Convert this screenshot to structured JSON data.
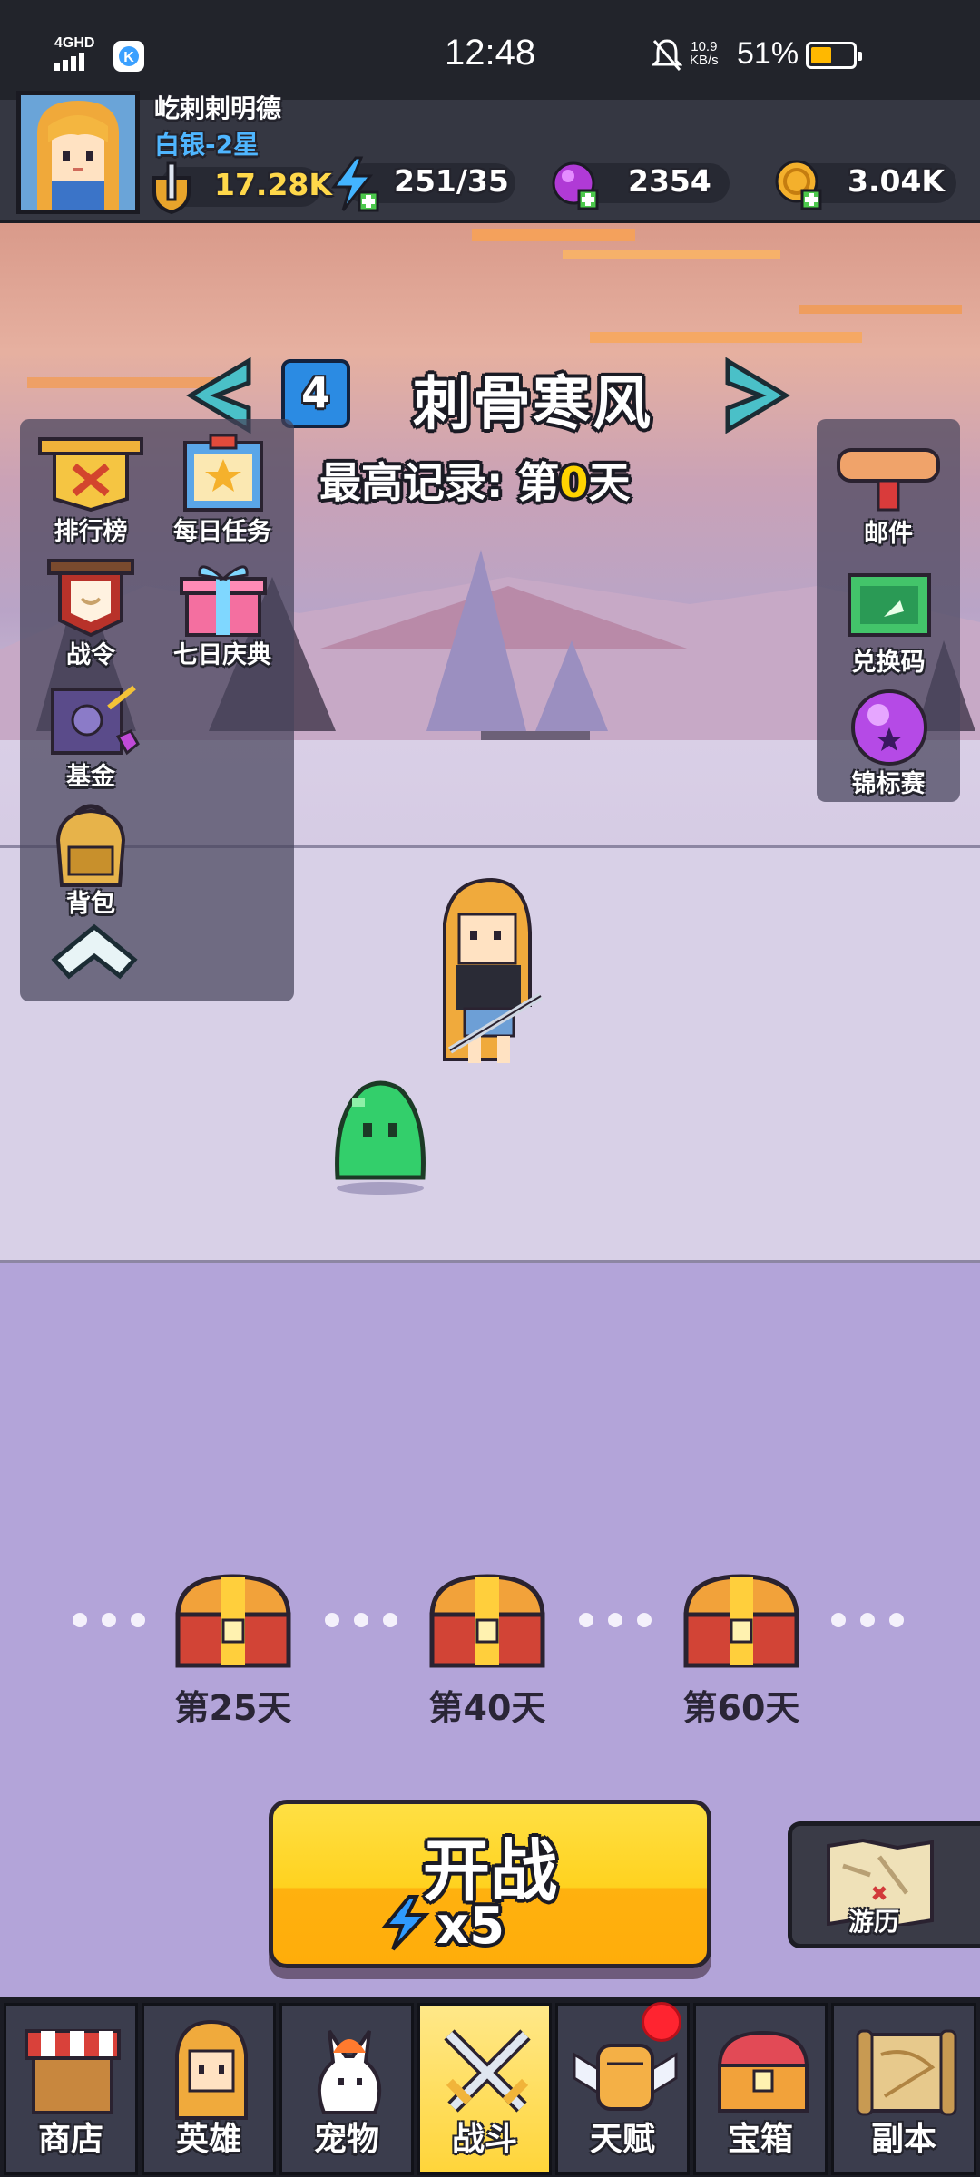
{
  "status_bar": {
    "network": "4GHD",
    "time": "12:48",
    "speed_value": "10.9",
    "speed_unit": "KB/s",
    "battery": "51%",
    "battery_level": 0.51
  },
  "player": {
    "name": "屹剌剌明德",
    "rank": "白银-2星",
    "power": "17.28K",
    "energy": "251/35",
    "gems": "2354",
    "gold": "3.04K"
  },
  "stage": {
    "number": "4",
    "title": "刺骨寒风",
    "record_prefix": "最高记录: 第",
    "record_value": "0",
    "record_suffix": "天"
  },
  "left_menu": [
    {
      "label": "排行榜",
      "icon": "leaderboard-icon"
    },
    {
      "label": "每日任务",
      "icon": "daily-task-icon"
    },
    {
      "label": "战令",
      "icon": "battle-pass-icon"
    },
    {
      "label": "七日庆典",
      "icon": "gift-box-icon"
    },
    {
      "label": "基金",
      "icon": "fund-safe-icon"
    },
    {
      "label": "背包",
      "icon": "backpack-icon"
    }
  ],
  "right_menu": [
    {
      "label": "邮件",
      "icon": "mail-scroll-icon"
    },
    {
      "label": "兑换码",
      "icon": "redeem-code-icon"
    },
    {
      "label": "锦标赛",
      "icon": "tournament-orb-icon"
    }
  ],
  "chests": [
    {
      "label": "第25天"
    },
    {
      "label": "第40天"
    },
    {
      "label": "第60天"
    }
  ],
  "battle_button": {
    "label": "开战",
    "cost": "x5"
  },
  "travel_button": {
    "label": "游历"
  },
  "nav": [
    {
      "label": "商店",
      "icon": "shop-icon",
      "active": false
    },
    {
      "label": "英雄",
      "icon": "hero-icon",
      "active": false
    },
    {
      "label": "宠物",
      "icon": "pet-icon",
      "active": false
    },
    {
      "label": "战斗",
      "icon": "crossed-swords-icon",
      "active": true
    },
    {
      "label": "天赋",
      "icon": "talent-fist-icon",
      "active": false,
      "badge": true
    },
    {
      "label": "宝箱",
      "icon": "treasure-chest-icon",
      "active": false
    },
    {
      "label": "副本",
      "icon": "dungeon-map-icon",
      "active": false
    }
  ]
}
